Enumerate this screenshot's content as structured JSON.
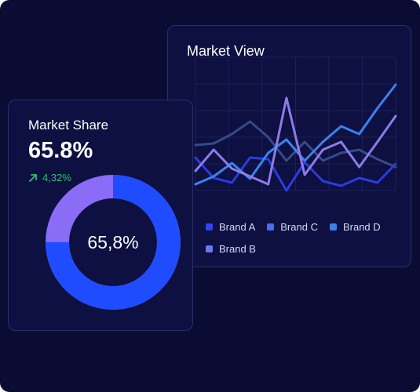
{
  "market_view": {
    "title": "Market View",
    "legend": [
      {
        "label": "Brand A",
        "color": "#3344ee"
      },
      {
        "label": "Brand C",
        "color": "#4a6cf0"
      },
      {
        "label": "Brand D",
        "color": "#3d7fe8"
      },
      {
        "label": "Brand B",
        "color": "#6a78f0"
      }
    ]
  },
  "market_share": {
    "title": "Market Share",
    "value": "65.8%",
    "change": "4,32%",
    "change_icon": "arrow-up-right-icon",
    "donut_label": "65,8%",
    "donut_fraction": 0.75,
    "colors": {
      "primary": "#1f4cff",
      "secondary": "#8a6cf7",
      "positive": "#1fc76b"
    }
  },
  "chart_data": {
    "type": "line",
    "series": [
      {
        "name": "Brand A",
        "color": "#2b3be0",
        "values": [
          52,
          26,
          20,
          52,
          50,
          10,
          46,
          22,
          16,
          26,
          20,
          44
        ]
      },
      {
        "name": "Brand C",
        "color": "#364a8a",
        "values": [
          68,
          70,
          82,
          98,
          78,
          48,
          72,
          48,
          58,
          62,
          50,
          40
        ]
      },
      {
        "name": "Brand D",
        "color": "#3b82f0",
        "values": [
          18,
          28,
          45,
          25,
          58,
          75,
          48,
          72,
          92,
          82,
          115,
          145
        ]
      },
      {
        "name": "Brand B",
        "color": "#8e7be8",
        "values": [
          35,
          62,
          38,
          28,
          18,
          128,
          30,
          62,
          72,
          40,
          72,
          105
        ]
      }
    ],
    "ylim": [
      0,
      160
    ]
  }
}
